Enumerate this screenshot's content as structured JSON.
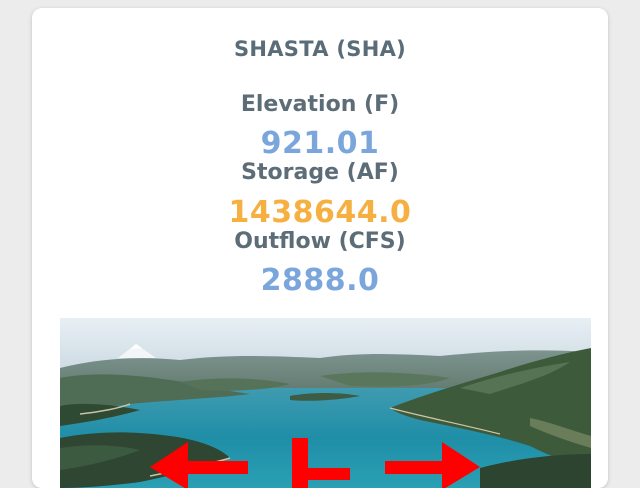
{
  "station": {
    "title": "SHASTA (SHA)"
  },
  "metrics": [
    {
      "label": "Elevation (F)",
      "value": "921.01",
      "color": "#7ba6dc"
    },
    {
      "label": "Storage (AF)",
      "value": "1438644.0",
      "color": "#f5b041"
    },
    {
      "label": "Outflow (CFS)",
      "value": "2888.0",
      "color": "#7ba6dc"
    }
  ],
  "photo": {
    "subject": "lake-reservoir-photo",
    "arrow_color": "#ff0000",
    "arrows": [
      "arrow-left-icon",
      "arrow-down-icon",
      "arrow-right-icon"
    ]
  }
}
